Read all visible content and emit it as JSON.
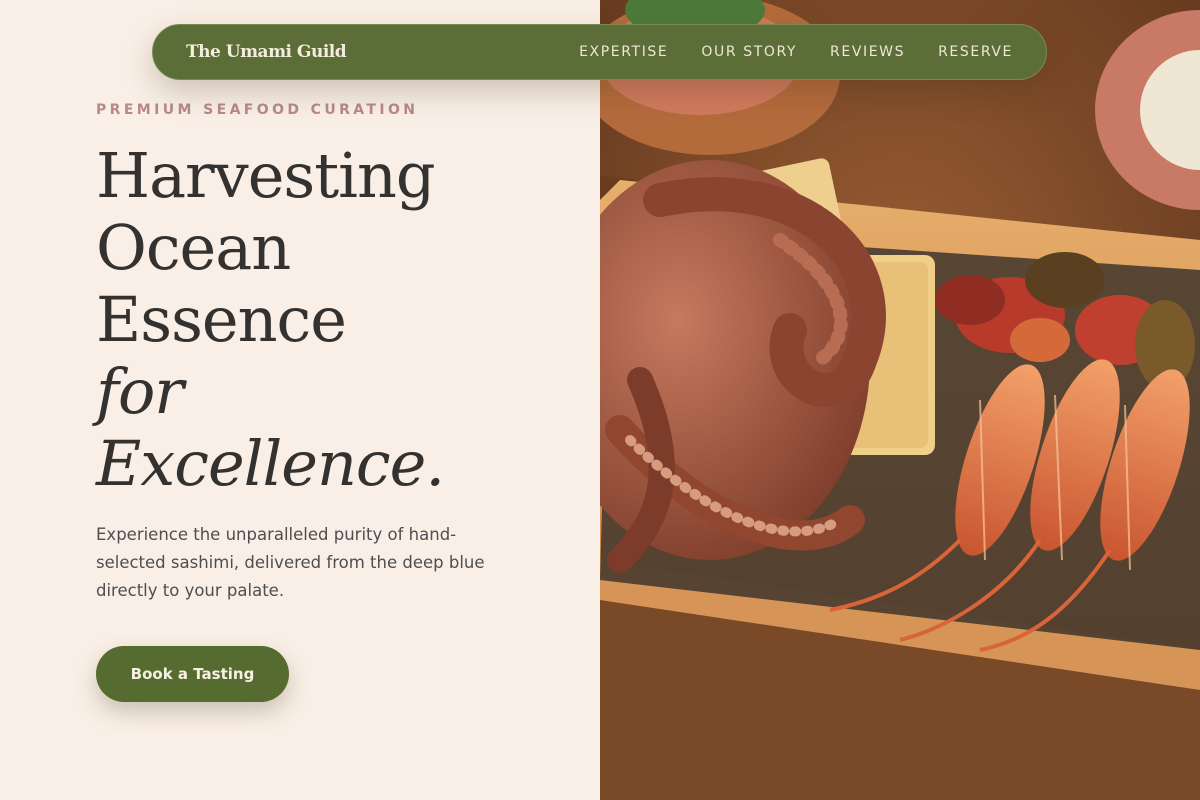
{
  "nav": {
    "brand": "The Umami Guild",
    "links": [
      "EXPERTISE",
      "OUR STORY",
      "REVIEWS",
      "RESERVE"
    ]
  },
  "hero": {
    "eyebrow": "PREMIUM SEAFOOD CURATION",
    "headline_lines": [
      "Harvesting",
      "Ocean",
      "Essence"
    ],
    "headline_italic_lines": [
      "for",
      "Excellence."
    ],
    "description": "Experience the unparalleled purity of hand-selected sashimi, delivered from the deep blue directly to your palate.",
    "cta_label": "Book a Tasting"
  },
  "colors": {
    "accent_green": "#5c6e38",
    "cream": "#f9efe6",
    "eyebrow_rose": "#b88a86",
    "ink": "#333230"
  },
  "image": {
    "subject": "grilled octopus, langoustines, mussels and tofu on a wooden platter"
  }
}
